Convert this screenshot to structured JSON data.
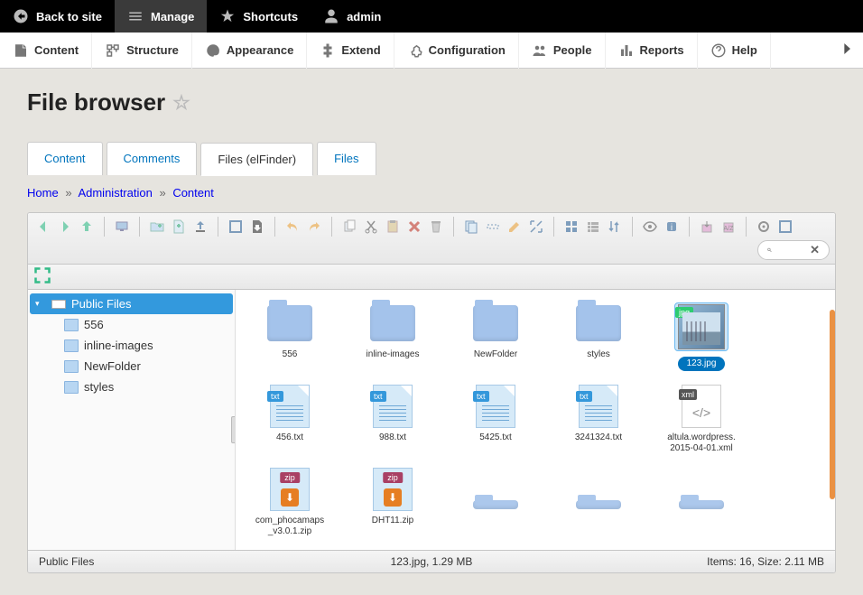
{
  "topbar": {
    "back": "Back to site",
    "manage": "Manage",
    "shortcuts": "Shortcuts",
    "user": "admin"
  },
  "adminmenu": {
    "content": "Content",
    "structure": "Structure",
    "appearance": "Appearance",
    "extend": "Extend",
    "configuration": "Configuration",
    "people": "People",
    "reports": "Reports",
    "help": "Help"
  },
  "page_title": "File browser",
  "tabs": {
    "content": "Content",
    "comments": "Comments",
    "files_elfinder": "Files (elFinder)",
    "files": "Files"
  },
  "breadcrumb": {
    "home": "Home",
    "administration": "Administration",
    "content": "Content"
  },
  "toolbar": {
    "back": "back",
    "forward": "forward",
    "up": "up",
    "netmount": "netmount",
    "newfolder": "newfolder",
    "newfile": "newfile",
    "upload": "upload",
    "open": "open",
    "download": "download",
    "undo": "undo",
    "redo": "redo",
    "copy": "copy",
    "cut": "cut",
    "paste": "paste",
    "rm": "rm",
    "empty": "empty",
    "duplicate": "duplicate",
    "rename": "rename",
    "edit": "edit",
    "resize": "resize",
    "selectall": "selectall",
    "selectnone": "selectnone",
    "selectinvert": "selectinvert",
    "view_icons": "view-icons",
    "view_list": "view-list",
    "sort": "sort",
    "preview": "preview",
    "info": "info",
    "extract": "extract",
    "archive": "archive",
    "settings": "settings",
    "fullscreen": "fullscreen",
    "search_placeholder": ""
  },
  "tree": {
    "root": "Public Files",
    "children": [
      "556",
      "inline-images",
      "NewFolder",
      "styles"
    ]
  },
  "files": [
    {
      "name": "556",
      "type": "folder"
    },
    {
      "name": "inline-images",
      "type": "folder"
    },
    {
      "name": "NewFolder",
      "type": "folder"
    },
    {
      "name": "styles",
      "type": "folder"
    },
    {
      "name": "123.jpg",
      "type": "jpg",
      "selected": true
    },
    {
      "name": "456.txt",
      "type": "txt"
    },
    {
      "name": "988.txt",
      "type": "txt"
    },
    {
      "name": "5425.txt",
      "type": "txt"
    },
    {
      "name": "3241324.txt",
      "type": "txt"
    },
    {
      "name": "altula.wordpress.2015-04-01.xml",
      "type": "xml"
    },
    {
      "name": "com_phocamaps_v3.0.1.zip",
      "type": "zip"
    },
    {
      "name": "DHT11.zip",
      "type": "zip"
    }
  ],
  "hidden_row_types": [
    "folder",
    "folder",
    "folder",
    "folder"
  ],
  "statusbar": {
    "path": "Public Files",
    "selection": "123.jpg, 1.29 MB",
    "summary": "Items: 16, Size: 2.11 MB"
  }
}
